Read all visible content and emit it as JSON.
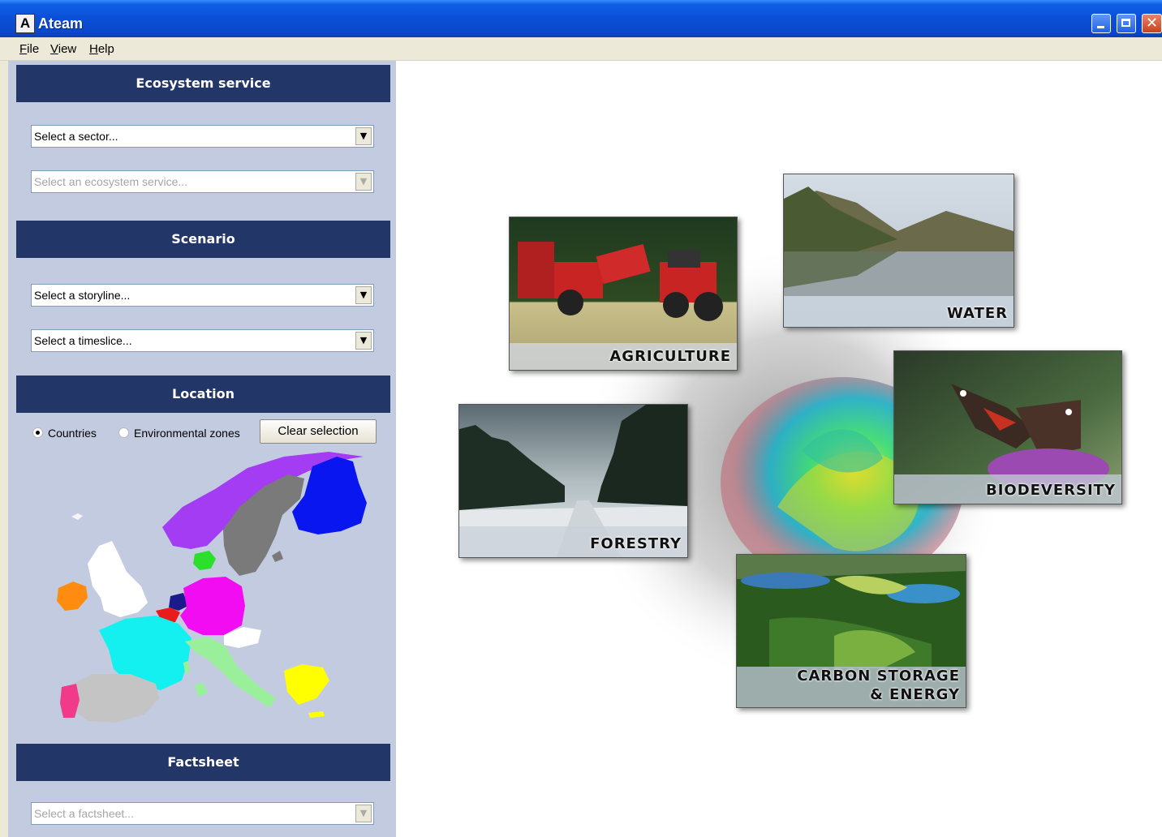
{
  "window": {
    "title": "Ateam",
    "icon_letter": "A"
  },
  "menu": [
    "File",
    "View",
    "Help"
  ],
  "sidebar": {
    "ecosystem_header": "Ecosystem service",
    "sector_combo": "Select a sector...",
    "service_combo": "Select an ecosystem service...",
    "scenario_header": "Scenario",
    "storyline_combo": "Select a storyline...",
    "timeslice_combo": "Select a timeslice...",
    "location_header": "Location",
    "radio_countries": "Countries",
    "radio_env_zones": "Environmental zones",
    "clear_button": "Clear selection",
    "factsheet_header": "Factsheet",
    "factsheet_combo": "Select a factsheet..."
  },
  "tiles": {
    "agriculture": "AGRICULTURE",
    "water": "WATER",
    "biodiversity": "BIODEVERSITY",
    "forestry": "FORESTRY",
    "carbon_line1": "CARBON STORAGE",
    "carbon_line2": "& ENERGY"
  },
  "colors": {
    "titlebar": "#0a4fd6",
    "panel_bg": "#c3cbe0",
    "section_header": "#233668"
  }
}
